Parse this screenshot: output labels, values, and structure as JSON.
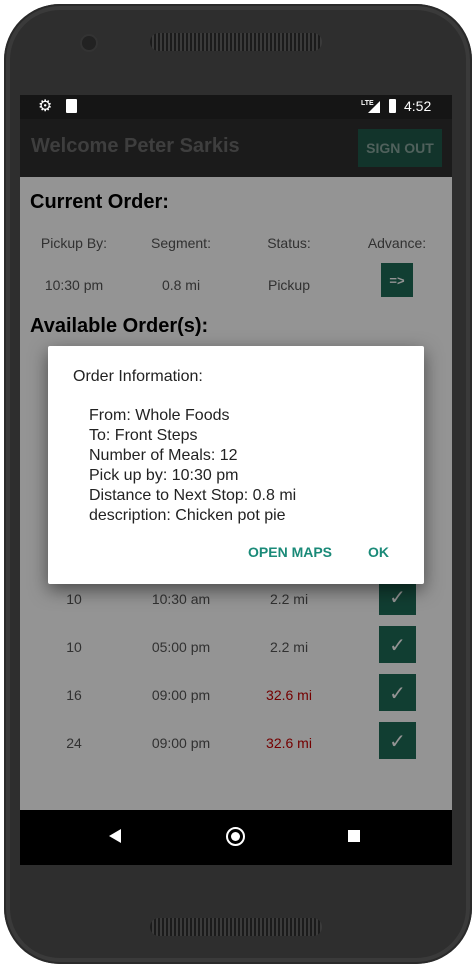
{
  "status_bar": {
    "network": "LTE",
    "time": "4:52"
  },
  "toolbar": {
    "title": "Welcome Peter Sarkis",
    "signout_label": "SIGN OUT"
  },
  "current_order": {
    "heading": "Current Order:",
    "headers": [
      "Pickup By:",
      "Segment:",
      "Status:",
      "Advance:"
    ],
    "pickup_by": "10:30 pm",
    "segment": "0.8 mi",
    "status": "Pickup",
    "advance_label": "=>"
  },
  "available_orders": {
    "heading": "Available Order(s):",
    "rows": [
      {
        "meals": "10",
        "time": "10:30 am",
        "distance": "2.2 mi",
        "far": false,
        "action": "✓"
      },
      {
        "meals": "10",
        "time": "05:00 pm",
        "distance": "2.2 mi",
        "far": false,
        "action": "✓"
      },
      {
        "meals": "16",
        "time": "09:00 pm",
        "distance": "32.6 mi",
        "far": true,
        "action": "✓"
      },
      {
        "meals": "24",
        "time": "09:00 pm",
        "distance": "32.6 mi",
        "far": true,
        "action": "✓"
      }
    ]
  },
  "dialog": {
    "title": "Order Information:",
    "lines": [
      "From: Whole Foods",
      "To: Front Steps",
      "Number of Meals: 12",
      "Pick up by: 10:30 pm",
      "Distance to Next Stop: 0.8 mi",
      "description: Chicken pot pie"
    ],
    "open_maps_label": "OPEN MAPS",
    "ok_label": "OK"
  },
  "colors": {
    "accent": "#1e6b57",
    "dialog_button": "#1a8a78",
    "far_distance": "#c80000",
    "toolbar": "#2f2f2f"
  },
  "icons": {
    "status_left": [
      "gear-icon",
      "sd-card-icon"
    ],
    "status_right": [
      "signal-icon",
      "battery-charging-icon"
    ],
    "nav": [
      "back-icon",
      "home-icon",
      "recents-icon"
    ]
  }
}
